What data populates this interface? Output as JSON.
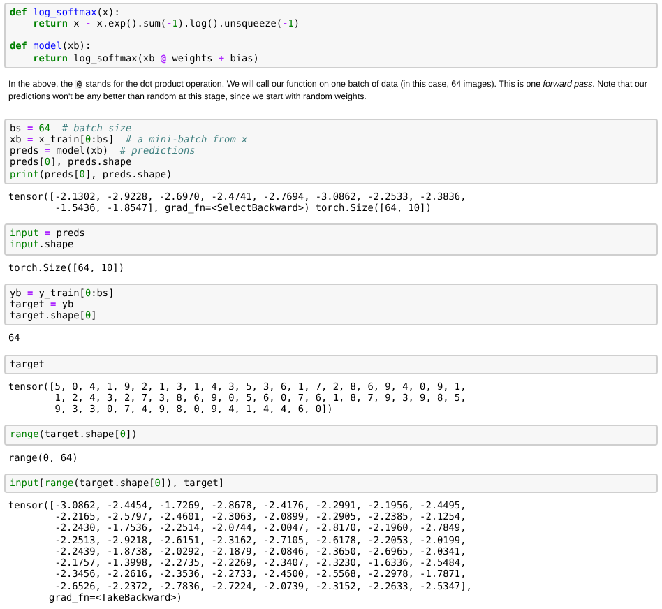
{
  "cells": [
    {
      "kind": "code",
      "blocks": [
        [
          [
            {
              "kind": "kw",
              "text": "def"
            },
            {
              "kind": "fn",
              "text": " log_softmax"
            },
            {
              "kind": "t",
              "text": "(x):"
            }
          ],
          [
            {
              "kind": "kw",
              "text": "    return"
            },
            {
              "kind": "t",
              "text": " x "
            },
            {
              "kind": "op",
              "text": "-"
            },
            {
              "kind": "t",
              "text": " x.exp().sum("
            },
            {
              "kind": "op",
              "text": "-"
            },
            {
              "kind": "num",
              "text": "1"
            },
            {
              "kind": "t",
              "text": ").log().unsqueeze("
            },
            {
              "kind": "op",
              "text": "-"
            },
            {
              "kind": "num",
              "text": "1"
            },
            {
              "kind": "t",
              "text": ")"
            }
          ]
        ],
        [
          [
            {
              "kind": "kw",
              "text": "def"
            },
            {
              "kind": "fn",
              "text": " model"
            },
            {
              "kind": "t",
              "text": "(xb):"
            }
          ],
          [
            {
              "kind": "kw",
              "text": "    return"
            },
            {
              "kind": "t",
              "text": " log_softmax(xb "
            },
            {
              "kind": "op",
              "text": "@"
            },
            {
              "kind": "t",
              "text": " weights "
            },
            {
              "kind": "op",
              "text": "+"
            },
            {
              "kind": "t",
              "text": " bias)"
            }
          ]
        ]
      ]
    },
    {
      "kind": "markdown",
      "before": "In the above, the",
      "code": "@",
      "after": "stands for the dot product operation. We will call our function on one batch of data (in this case, 64 images). This is one *forward pass*. Note that our predictions won't be any better than random at this stage, since we start with random weights."
    },
    {
      "kind": "code",
      "blocks": [
        [
          [
            {
              "kind": "t",
              "text": "bs "
            },
            {
              "kind": "op",
              "text": "="
            },
            {
              "kind": "num",
              "text": " 64"
            },
            {
              "kind": "cmt",
              "text": "  # batch size"
            }
          ],
          [
            {
              "kind": "t",
              "text": "xb "
            },
            {
              "kind": "op",
              "text": "="
            },
            {
              "kind": "t",
              "text": " x_train["
            },
            {
              "kind": "num",
              "text": "0"
            },
            {
              "kind": "t",
              "text": ":bs]"
            },
            {
              "kind": "cmt",
              "text": "  # a mini-batch from x"
            }
          ],
          [
            {
              "kind": "t",
              "text": "preds "
            },
            {
              "kind": "op",
              "text": "="
            },
            {
              "kind": "t",
              "text": " model(xb)"
            },
            {
              "kind": "cmt",
              "text": "  # predictions"
            }
          ],
          [
            {
              "kind": "t",
              "text": "preds["
            },
            {
              "kind": "num",
              "text": "0"
            },
            {
              "kind": "t",
              "text": "], preds.shape"
            }
          ],
          [
            {
              "kind": "bi",
              "text": "print"
            },
            {
              "kind": "t",
              "text": "(preds["
            },
            {
              "kind": "num",
              "text": "0"
            },
            {
              "kind": "t",
              "text": "], preds.shape)"
            }
          ]
        ]
      ]
    },
    {
      "kind": "output",
      "lines": [
        "tensor([-2.1302, -2.9228, -2.6970, -2.4741, -2.7694, -3.0862, -2.2533, -2.3836,",
        "        -1.5436, -1.8547], grad_fn=<SelectBackward>) torch.Size([64, 10])"
      ]
    },
    {
      "kind": "code",
      "blocks": [
        [
          [
            {
              "kind": "bi",
              "text": "input"
            },
            {
              "kind": "op",
              "text": " ="
            },
            {
              "kind": "t",
              "text": " preds"
            }
          ],
          [
            {
              "kind": "bi",
              "text": "input"
            },
            {
              "kind": "t",
              "text": ".shape"
            }
          ]
        ]
      ]
    },
    {
      "kind": "output",
      "lines": [
        "torch.Size([64, 10])"
      ]
    },
    {
      "kind": "code",
      "blocks": [
        [
          [
            {
              "kind": "t",
              "text": "yb "
            },
            {
              "kind": "op",
              "text": "="
            },
            {
              "kind": "t",
              "text": " y_train["
            },
            {
              "kind": "num",
              "text": "0"
            },
            {
              "kind": "t",
              "text": ":bs]"
            }
          ],
          [
            {
              "kind": "t",
              "text": "target "
            },
            {
              "kind": "op",
              "text": "="
            },
            {
              "kind": "t",
              "text": " yb"
            }
          ],
          [
            {
              "kind": "t",
              "text": "target.shape["
            },
            {
              "kind": "num",
              "text": "0"
            },
            {
              "kind": "t",
              "text": "]"
            }
          ]
        ]
      ]
    },
    {
      "kind": "output",
      "lines": [
        "64"
      ]
    },
    {
      "kind": "code",
      "blocks": [
        [
          [
            {
              "kind": "t",
              "text": "target"
            }
          ]
        ]
      ]
    },
    {
      "kind": "output",
      "lines": [
        "tensor([5, 0, 4, 1, 9, 2, 1, 3, 1, 4, 3, 5, 3, 6, 1, 7, 2, 8, 6, 9, 4, 0, 9, 1,",
        "        1, 2, 4, 3, 2, 7, 3, 8, 6, 9, 0, 5, 6, 0, 7, 6, 1, 8, 7, 9, 3, 9, 8, 5,",
        "        9, 3, 3, 0, 7, 4, 9, 8, 0, 9, 4, 1, 4, 4, 6, 0])"
      ]
    },
    {
      "kind": "code",
      "blocks": [
        [
          [
            {
              "kind": "bi",
              "text": "range"
            },
            {
              "kind": "t",
              "text": "(target.shape["
            },
            {
              "kind": "num",
              "text": "0"
            },
            {
              "kind": "t",
              "text": "])"
            }
          ]
        ]
      ]
    },
    {
      "kind": "output",
      "lines": [
        "range(0, 64)"
      ]
    },
    {
      "kind": "code",
      "blocks": [
        [
          [
            {
              "kind": "bi",
              "text": "input"
            },
            {
              "kind": "t",
              "text": "["
            },
            {
              "kind": "bi",
              "text": "range"
            },
            {
              "kind": "t",
              "text": "(target.shape["
            },
            {
              "kind": "num",
              "text": "0"
            },
            {
              "kind": "t",
              "text": "]), target]"
            }
          ]
        ]
      ]
    },
    {
      "kind": "output",
      "lines": [
        "tensor([-3.0862, -2.4454, -1.7269, -2.8678, -2.4176, -2.2991, -2.1956, -2.4495,",
        "        -2.2165, -2.5797, -2.4601, -2.3063, -2.0899, -2.2905, -2.2385, -2.1254,",
        "        -2.2430, -1.7536, -2.2514, -2.0744, -2.0047, -2.8170, -2.1960, -2.7849,",
        "        -2.2513, -2.9218, -2.6151, -2.3162, -2.7105, -2.6178, -2.2053, -2.0199,",
        "        -2.2439, -1.8738, -2.0292, -2.1879, -2.0846, -2.3650, -2.6965, -2.0341,",
        "        -2.1757, -1.3998, -2.2735, -2.2269, -2.3407, -2.3230, -1.6336, -2.5484,",
        "        -2.3456, -2.2616, -2.3536, -2.2733, -2.4500, -2.5568, -2.2978, -1.7871,",
        "        -2.6526, -2.2372, -2.7836, -2.7224, -2.0739, -2.3152, -2.2633, -2.5347],",
        "       grad_fn=<TakeBackward>)"
      ]
    }
  ]
}
